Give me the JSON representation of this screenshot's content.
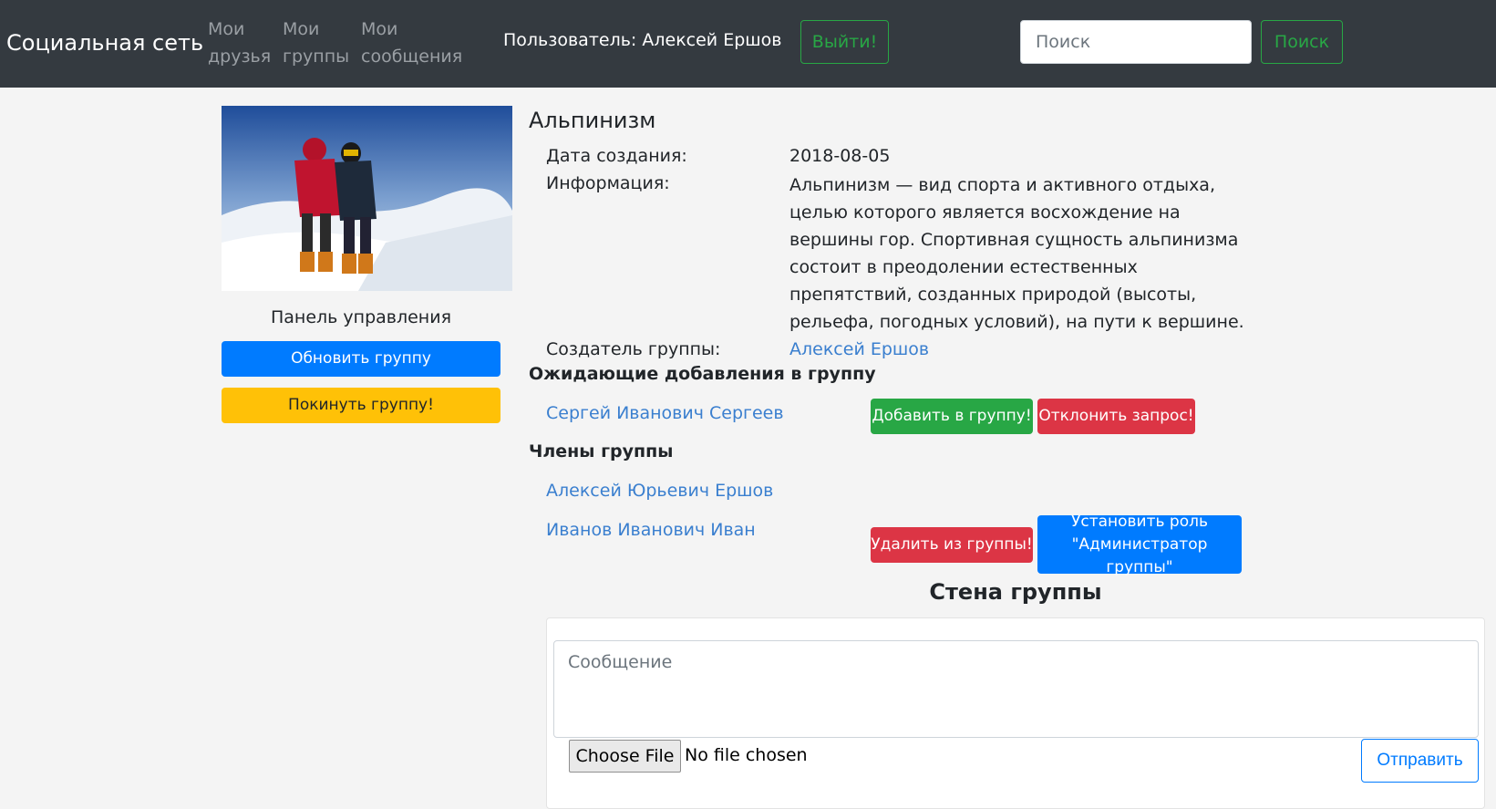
{
  "navbar": {
    "brand": "Социальная сеть",
    "links": [
      {
        "line1": "Мои",
        "line2": "друзья"
      },
      {
        "line1": "Мои",
        "line2": "группы"
      },
      {
        "line1": "Мои",
        "line2": "сообщения"
      }
    ],
    "user_label": "Пользователь: Алексей Ершов",
    "logout_label": "Выйти!",
    "search_placeholder": "Поиск",
    "search_button": "Поиск",
    "background_color": "#343a40"
  },
  "sidebar": {
    "photo_icon": "mountaineers-photo",
    "panel_title": "Панель управления",
    "update_button": "Обновить группу",
    "leave_button": "Покинуть группу!"
  },
  "group": {
    "name": "Альпинизм",
    "created_label": "Дата создания:",
    "created_value": "2018-08-05",
    "info_label": "Информация:",
    "info_value": "Альпинизм — вид спорта и активного отдыха, целью которого является восхождение на вершины гор. Спортивная сущность альпинизма состоит в преодолении естественных препятствий, созданных природой (высоты, рельефа, погодных условий), на пути к вершине.",
    "creator_label": "Создатель группы:",
    "creator_value": "Алексей Ершов"
  },
  "pending": {
    "title": "Ожидающие добавления в группу",
    "requests": [
      {
        "name": "Сергей Иванович Сергеев",
        "accept": "Добавить в группу!",
        "reject": "Отклонить запрос!"
      }
    ]
  },
  "members": {
    "title": "Члены группы",
    "list": [
      {
        "name": "Алексей Юрьевич Ершов"
      },
      {
        "name": "Иванов Иванович Иван",
        "remove": "Удалить из группы!",
        "set_role_line1": "Установить роль",
        "set_role_line2": "\"Администратор группы\""
      }
    ]
  },
  "wall": {
    "title": "Стена группы",
    "message_placeholder": "Сообщение",
    "file_button": "Choose File",
    "file_status": "No file chosen",
    "send_button": "Отправить"
  },
  "colors": {
    "primary": "#007bff",
    "success": "#28a745",
    "danger": "#dc3545",
    "warning": "#ffc107",
    "link": "#3a7fcf"
  }
}
